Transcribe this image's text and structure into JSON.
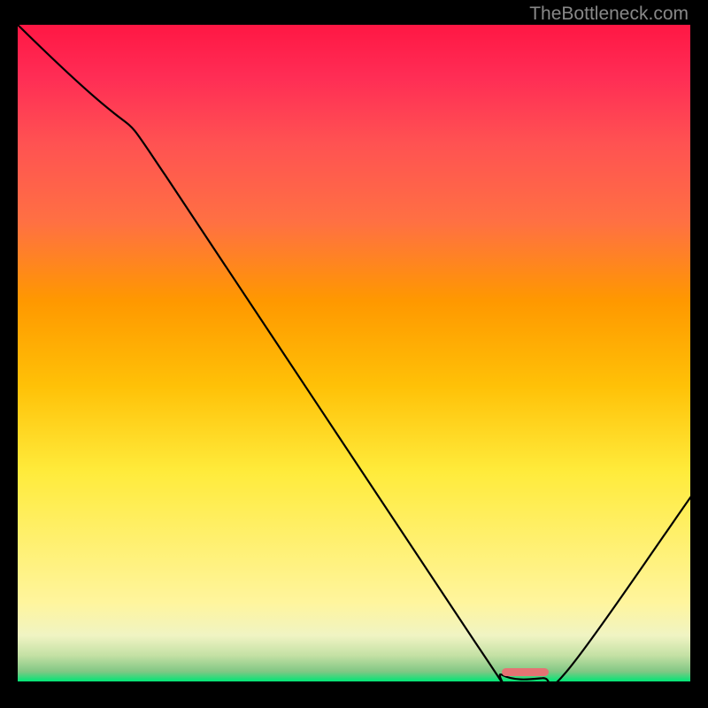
{
  "attribution": "TheBottleneck.com",
  "chart_data": {
    "type": "line",
    "title": "",
    "xlabel": "",
    "ylabel": "",
    "x_range": [
      0,
      100
    ],
    "y_range": [
      0,
      100
    ],
    "series": [
      {
        "name": "bottleneck-curve",
        "color": "#000000",
        "points": [
          {
            "x": 0,
            "y": 100
          },
          {
            "x": 18,
            "y": 82
          },
          {
            "x": 22,
            "y": 77
          },
          {
            "x": 68,
            "y": 6
          },
          {
            "x": 72,
            "y": 1
          },
          {
            "x": 78,
            "y": 0.5
          },
          {
            "x": 82,
            "y": 2
          },
          {
            "x": 100,
            "y": 28
          }
        ]
      }
    ],
    "marker": {
      "x_start": 72,
      "x_end": 79,
      "y": 1.5,
      "color": "#e57373"
    },
    "background_gradient": {
      "type": "vertical",
      "stops": [
        {
          "offset": 0.0,
          "color": "#ff1744"
        },
        {
          "offset": 0.08,
          "color": "#ff2d55"
        },
        {
          "offset": 0.18,
          "color": "#ff5252"
        },
        {
          "offset": 0.3,
          "color": "#ff7043"
        },
        {
          "offset": 0.42,
          "color": "#ff9800"
        },
        {
          "offset": 0.55,
          "color": "#ffc107"
        },
        {
          "offset": 0.68,
          "color": "#ffeb3b"
        },
        {
          "offset": 0.8,
          "color": "#fff176"
        },
        {
          "offset": 0.88,
          "color": "#fff59d"
        },
        {
          "offset": 0.93,
          "color": "#f0f4c3"
        },
        {
          "offset": 0.96,
          "color": "#c5e1a5"
        },
        {
          "offset": 0.985,
          "color": "#81c784"
        },
        {
          "offset": 1.0,
          "color": "#00e676"
        }
      ]
    }
  }
}
